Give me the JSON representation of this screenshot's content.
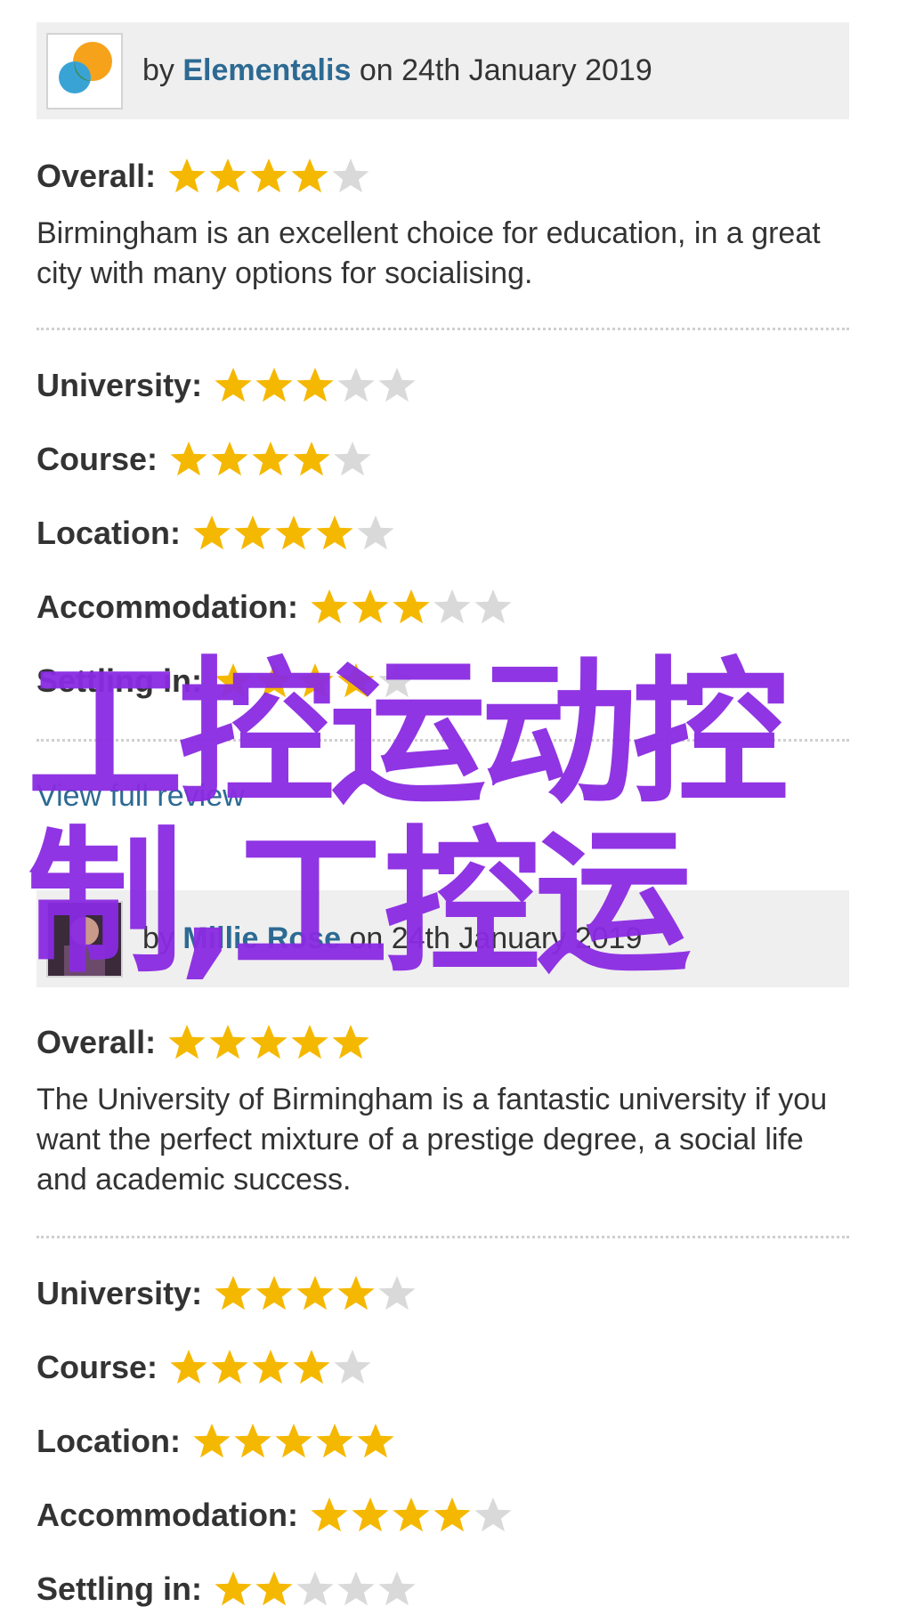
{
  "colors": {
    "star_filled": "#f5b800",
    "star_empty": "#d9d9d9",
    "link": "#2c6a93",
    "header_bg": "#efefef",
    "watermark": "#8a2be2"
  },
  "reviews": [
    {
      "by": "by",
      "author": "Elementalis",
      "on_date": "on 24th January 2019",
      "overall_label": "Overall:",
      "overall_rating": 4,
      "text": "Birmingham is an excellent choice for education, in a great city with many options for socialising.",
      "ratings": [
        {
          "label": "University:",
          "value": 3
        },
        {
          "label": "Course:",
          "value": 4
        },
        {
          "label": "Location:",
          "value": 4
        },
        {
          "label": "Accommodation:",
          "value": 3
        },
        {
          "label": "Settling in:",
          "value": 4
        }
      ],
      "link_text": "View full review"
    },
    {
      "by": "by",
      "author": "Millie Rose",
      "on_date": "on 24th January 2019",
      "overall_label": "Overall:",
      "overall_rating": 5,
      "text": "The University of Birmingham is a fantastic university if you want the perfect mixture of a prestige degree, a social life and academic success.",
      "ratings": [
        {
          "label": "University:",
          "value": 4
        },
        {
          "label": "Course:",
          "value": 4
        },
        {
          "label": "Location:",
          "value": 5
        },
        {
          "label": "Accommodation:",
          "value": 4
        },
        {
          "label": "Settling in:",
          "value": 2
        }
      ]
    }
  ],
  "watermark_text": "工控运动控制,工控运"
}
